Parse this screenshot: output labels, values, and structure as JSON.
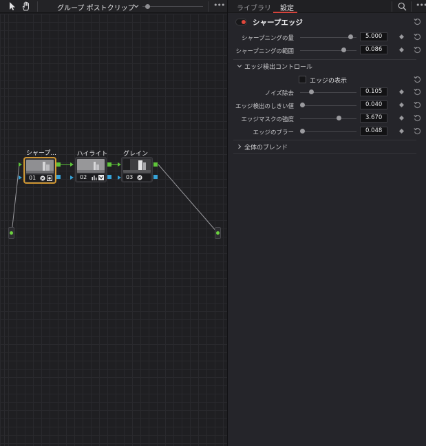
{
  "toolbar": {
    "mode_title": "グループ ポストクリップ",
    "icons": [
      "pointer-icon",
      "hand-icon",
      "chevron-down-icon",
      "more-icon"
    ],
    "zoom_level": 0.05
  },
  "nodes": [
    {
      "label": "シャープ...",
      "number": "01",
      "selected": true
    },
    {
      "label": "ハイライト",
      "number": "02",
      "selected": false
    },
    {
      "label": "グレイン",
      "number": "03",
      "selected": false
    }
  ],
  "inspector": {
    "tabs": [
      {
        "label": "ライブラリ",
        "active": false
      },
      {
        "label": "設定",
        "active": true
      }
    ],
    "effect": {
      "title": "シャープエッジ",
      "enabled": true
    },
    "params": [
      {
        "label": "シャープニングの量",
        "value": "5.000",
        "position": 0.93
      },
      {
        "label": "シャープニングの範囲",
        "value": "0.086",
        "position": 0.8
      }
    ],
    "edge_group": {
      "title": "エッジ検出コントロール",
      "expanded": true,
      "show_edges_label": "エッジの表示",
      "show_edges_checked": false,
      "params": [
        {
          "label": "ノイズ除去",
          "value": "0.105",
          "position": 0.17
        },
        {
          "label": "エッジ検出のしきい値",
          "value": "0.040",
          "position": 0.0
        },
        {
          "label": "エッジマスクの強度",
          "value": "3.670",
          "position": 0.7
        },
        {
          "label": "エッジのブラー",
          "value": "0.048",
          "position": 0.0
        }
      ]
    },
    "blend_group": {
      "title": "全体のブレンド",
      "expanded": false
    }
  },
  "colors": {
    "accent_red": "#d6433b",
    "selected_node": "#d9a13a",
    "rgb_link": "#5ec43a",
    "alpha_link": "#36a3d9"
  }
}
